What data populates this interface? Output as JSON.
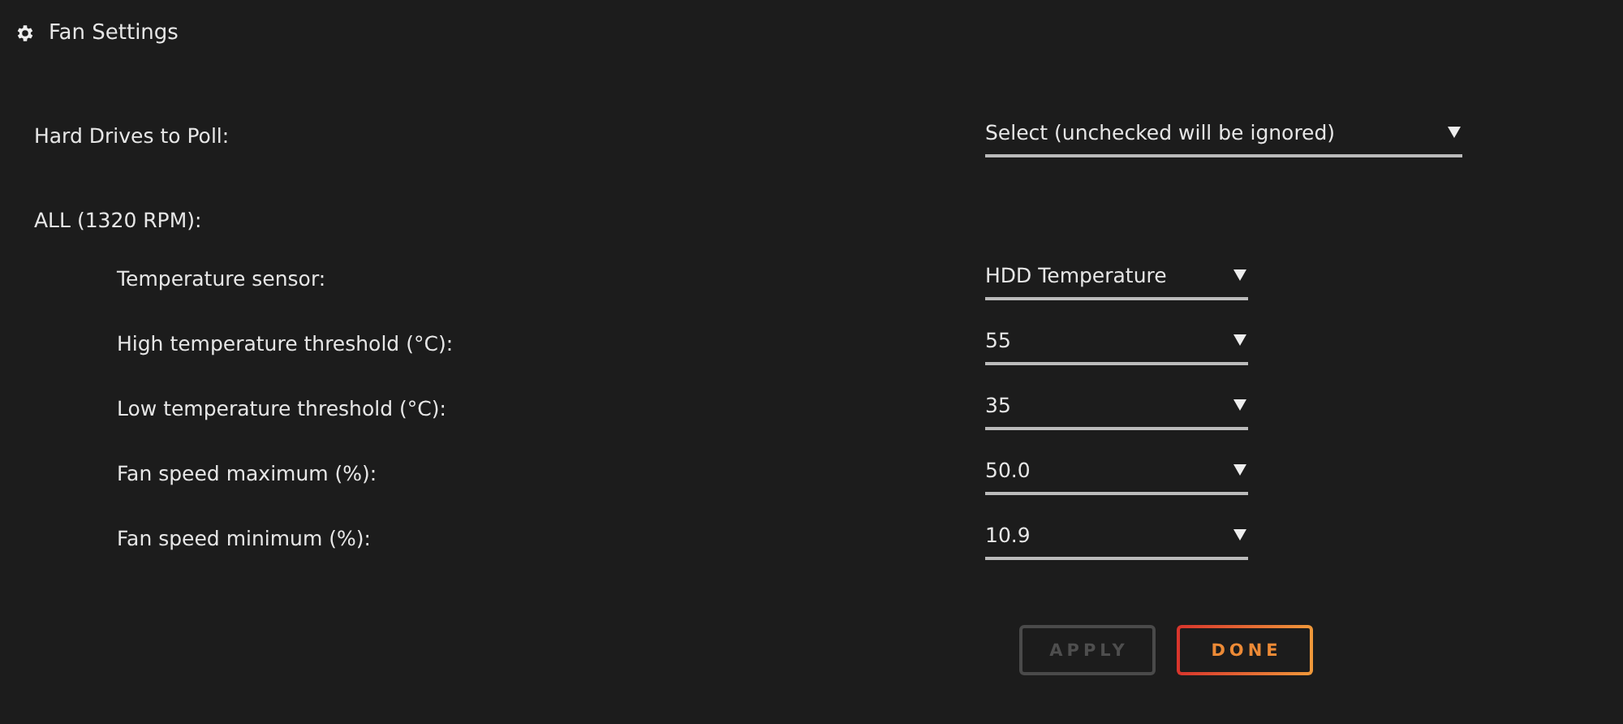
{
  "header": {
    "title": "Fan Settings"
  },
  "drives": {
    "label": "Hard Drives to Poll:",
    "value": "Select (unchecked will be ignored)"
  },
  "fan": {
    "label": "ALL (1320 RPM):",
    "settings": [
      {
        "label": "Temperature sensor:",
        "value": "HDD Temperature"
      },
      {
        "label": "High temperature threshold (°C):",
        "value": "55"
      },
      {
        "label": "Low temperature threshold (°C):",
        "value": "35"
      },
      {
        "label": "Fan speed maximum (%):",
        "value": "50.0"
      },
      {
        "label": "Fan speed minimum (%):",
        "value": "10.9"
      }
    ]
  },
  "buttons": [
    {
      "label": "APPLY",
      "disabled": true
    },
    {
      "label": "DONE",
      "disabled": false
    }
  ]
}
